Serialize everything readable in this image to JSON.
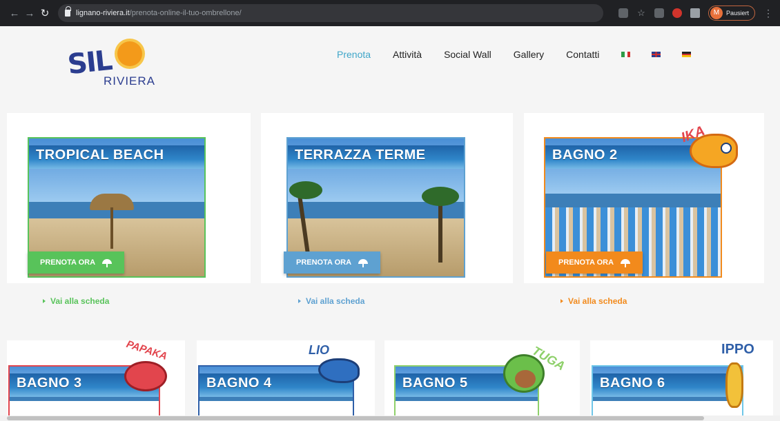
{
  "browser": {
    "back_icon": "arrow-left-icon",
    "forward_icon": "arrow-right-icon",
    "reload_icon": "reload-icon",
    "url_host": "lignano-riviera.it",
    "url_path": "/prenota-online-il-tuo-ombrellone/",
    "profile_initial": "M",
    "profile_status": "Pausiert"
  },
  "logo": {
    "brand": "SIL",
    "sub": "RIVIERA"
  },
  "menu": {
    "items": [
      "Prenota",
      "Attività",
      "Social Wall",
      "Gallery",
      "Contatti"
    ],
    "active": "Prenota",
    "flags": [
      "italian-flag-icon",
      "uk-flag-icon",
      "german-flag-icon"
    ]
  },
  "colors": {
    "green": "#58c35a",
    "blue": "#5ea1d1",
    "orange": "#f28a1c",
    "red": "#e2454d",
    "light_green": "#8ed06a",
    "light_blue": "#6ec6e8"
  },
  "cards": [
    {
      "title": "TROPICAL BEACH",
      "button": "PRENOTA ORA",
      "link": "Vai alla scheda",
      "color": "#58c35a"
    },
    {
      "title": "TERRAZZA TERME",
      "button": "PRENOTA ORA",
      "link": "Vai alla scheda",
      "color": "#5ea1d1"
    },
    {
      "title": "BAGNO 2",
      "button": "PRENOTA ORA",
      "link": "Vai alla scheda",
      "color": "#f28a1c",
      "mascot": "IKA"
    }
  ],
  "lower_cards": [
    {
      "title": "BAGNO 3",
      "mascot": "PAPAKA",
      "color": "#e2454d"
    },
    {
      "title": "BAGNO 4",
      "mascot": "LIO",
      "color": "#2f5fa8"
    },
    {
      "title": "BAGNO 5",
      "mascot": "TUGA",
      "color": "#8ed06a"
    },
    {
      "title": "BAGNO 6",
      "mascot": "IPPO",
      "color": "#6ec6e8"
    }
  ]
}
